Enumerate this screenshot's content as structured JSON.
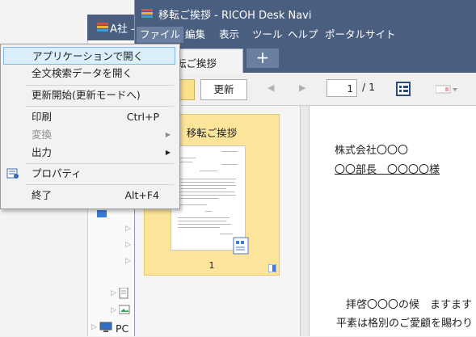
{
  "background_window": {
    "title": "A社 -",
    "tree_items": [
      {
        "label": ""
      },
      {
        "label": ""
      },
      {
        "label": ""
      },
      {
        "label": ""
      },
      {
        "label": ""
      },
      {
        "label": "PC"
      }
    ]
  },
  "window": {
    "title": "移転ご挨拶 - RICOH Desk Navi"
  },
  "menubar": {
    "items": [
      {
        "label": "ファイル",
        "active": true
      },
      {
        "label": "編集"
      },
      {
        "label": "表示"
      },
      {
        "label": "ツール"
      },
      {
        "label": "ヘルプ"
      },
      {
        "label": "ポータルサイト"
      }
    ]
  },
  "tabs": {
    "active_tab_label": "転ご挨拶",
    "new_tab_label": "+"
  },
  "toolbar": {
    "update_label": "更新",
    "page_current": "1",
    "page_total": "/ 1"
  },
  "file_menu": {
    "items": [
      {
        "label": "アプリケーションで開く",
        "highlighted": true
      },
      {
        "label": "全文検索データを開く"
      },
      {
        "label": "更新開始(更新モードへ)"
      },
      {
        "label": "印刷",
        "shortcut": "Ctrl+P"
      },
      {
        "label": "変換",
        "disabled": true,
        "submenu": true
      },
      {
        "label": "出力",
        "submenu": true
      },
      {
        "label": "プロパティ",
        "icon": "properties-icon"
      },
      {
        "label": "終了",
        "shortcut": "Alt+F4"
      }
    ]
  },
  "thumbnail": {
    "title": "移転ご挨拶",
    "page_number": "1"
  },
  "document": {
    "lines": [
      "株式会社〇〇〇",
      "〇〇部長　〇〇〇〇様",
      "拝啓〇〇〇の候　ますます",
      "平素は格別のご愛顧を賜わり"
    ]
  },
  "colors": {
    "titlebar": "#4a5f80",
    "menu_highlight": "#dbeefc",
    "thumb_bg": "#fce59a"
  }
}
